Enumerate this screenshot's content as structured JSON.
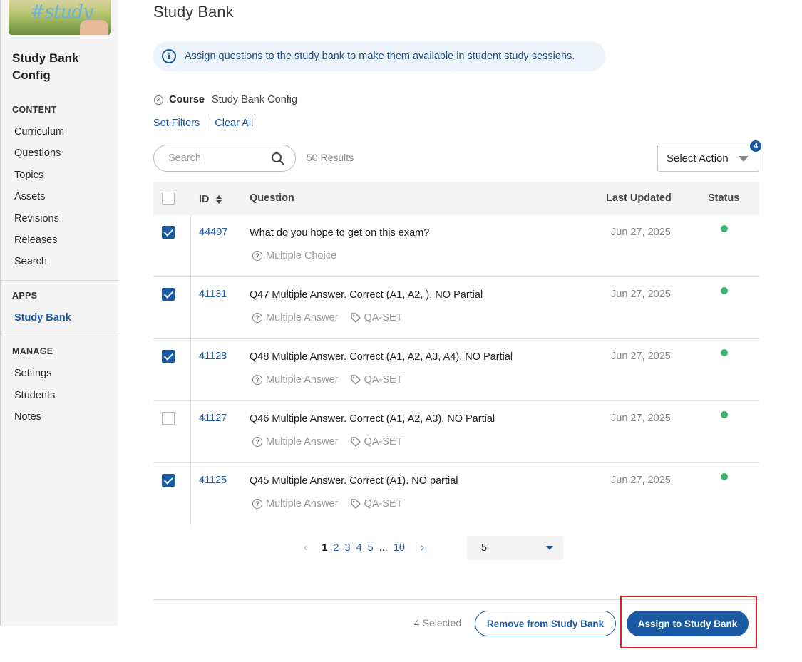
{
  "sidebar": {
    "thumb_text": "#study",
    "app_title": "Study Bank Config",
    "sections": {
      "content": "CONTENT",
      "apps": "APPS",
      "manage": "MANAGE"
    },
    "content_items": [
      "Curriculum",
      "Questions",
      "Topics",
      "Assets",
      "Revisions",
      "Releases",
      "Search"
    ],
    "apps_items": [
      "Study Bank"
    ],
    "manage_items": [
      "Settings",
      "Students",
      "Notes"
    ],
    "active_item": "Study Bank"
  },
  "main": {
    "title": "Study Bank",
    "info_text": "Assign questions to the study bank to make them available in student study sessions.",
    "filter": {
      "label": "Course",
      "value": "Study Bank Config"
    },
    "links": {
      "set_filters": "Set Filters",
      "clear_all": "Clear All"
    },
    "search": {
      "placeholder": "Search"
    },
    "results": "50 Results",
    "select_action": {
      "label": "Select Action",
      "badge": "4"
    }
  },
  "table": {
    "headers": {
      "id": "ID",
      "question": "Question",
      "last_updated": "Last Updated",
      "status": "Status"
    },
    "rows": [
      {
        "checked": true,
        "id": "44497",
        "question": "What do you hope to get on this exam?",
        "type": "Multiple Choice",
        "tag": "",
        "date": "Jun 27, 2025",
        "status_color": "#3cb371"
      },
      {
        "checked": true,
        "id": "41131",
        "question": "Q47 Multiple Answer. Correct (A1, A2, ). NO Partial",
        "type": "Multiple Answer",
        "tag": "QA-SET",
        "date": "Jun 27, 2025",
        "status_color": "#3cb371"
      },
      {
        "checked": true,
        "id": "41128",
        "question": "Q48 Multiple Answer. Correct (A1, A2, A3, A4). NO Partial",
        "type": "Multiple Answer",
        "tag": "QA-SET",
        "date": "Jun 27, 2025",
        "status_color": "#3cb371"
      },
      {
        "checked": false,
        "id": "41127",
        "question": "Q46 Multiple Answer. Correct (A1, A2, A3). NO Partial",
        "type": "Multiple Answer",
        "tag": "QA-SET",
        "date": "Jun 27, 2025",
        "status_color": "#3cb371"
      },
      {
        "checked": true,
        "id": "41125",
        "question": "Q45 Multiple Answer. Correct (A1). NO partial",
        "type": "Multiple Answer",
        "tag": "QA-SET",
        "date": "Jun 27, 2025",
        "status_color": "#3cb371"
      }
    ]
  },
  "pagination": {
    "pages": [
      "1",
      "2",
      "3",
      "4",
      "5"
    ],
    "current": "1",
    "ellipsis": "...",
    "last": "10",
    "per_page": "5"
  },
  "footer": {
    "selected": "4 Selected",
    "remove_label": "Remove from Study Bank",
    "assign_label": "Assign to Study Bank"
  },
  "colors": {
    "accent": "#1a5aa3",
    "status_active": "#3cb371",
    "highlight": "#e0202a"
  }
}
